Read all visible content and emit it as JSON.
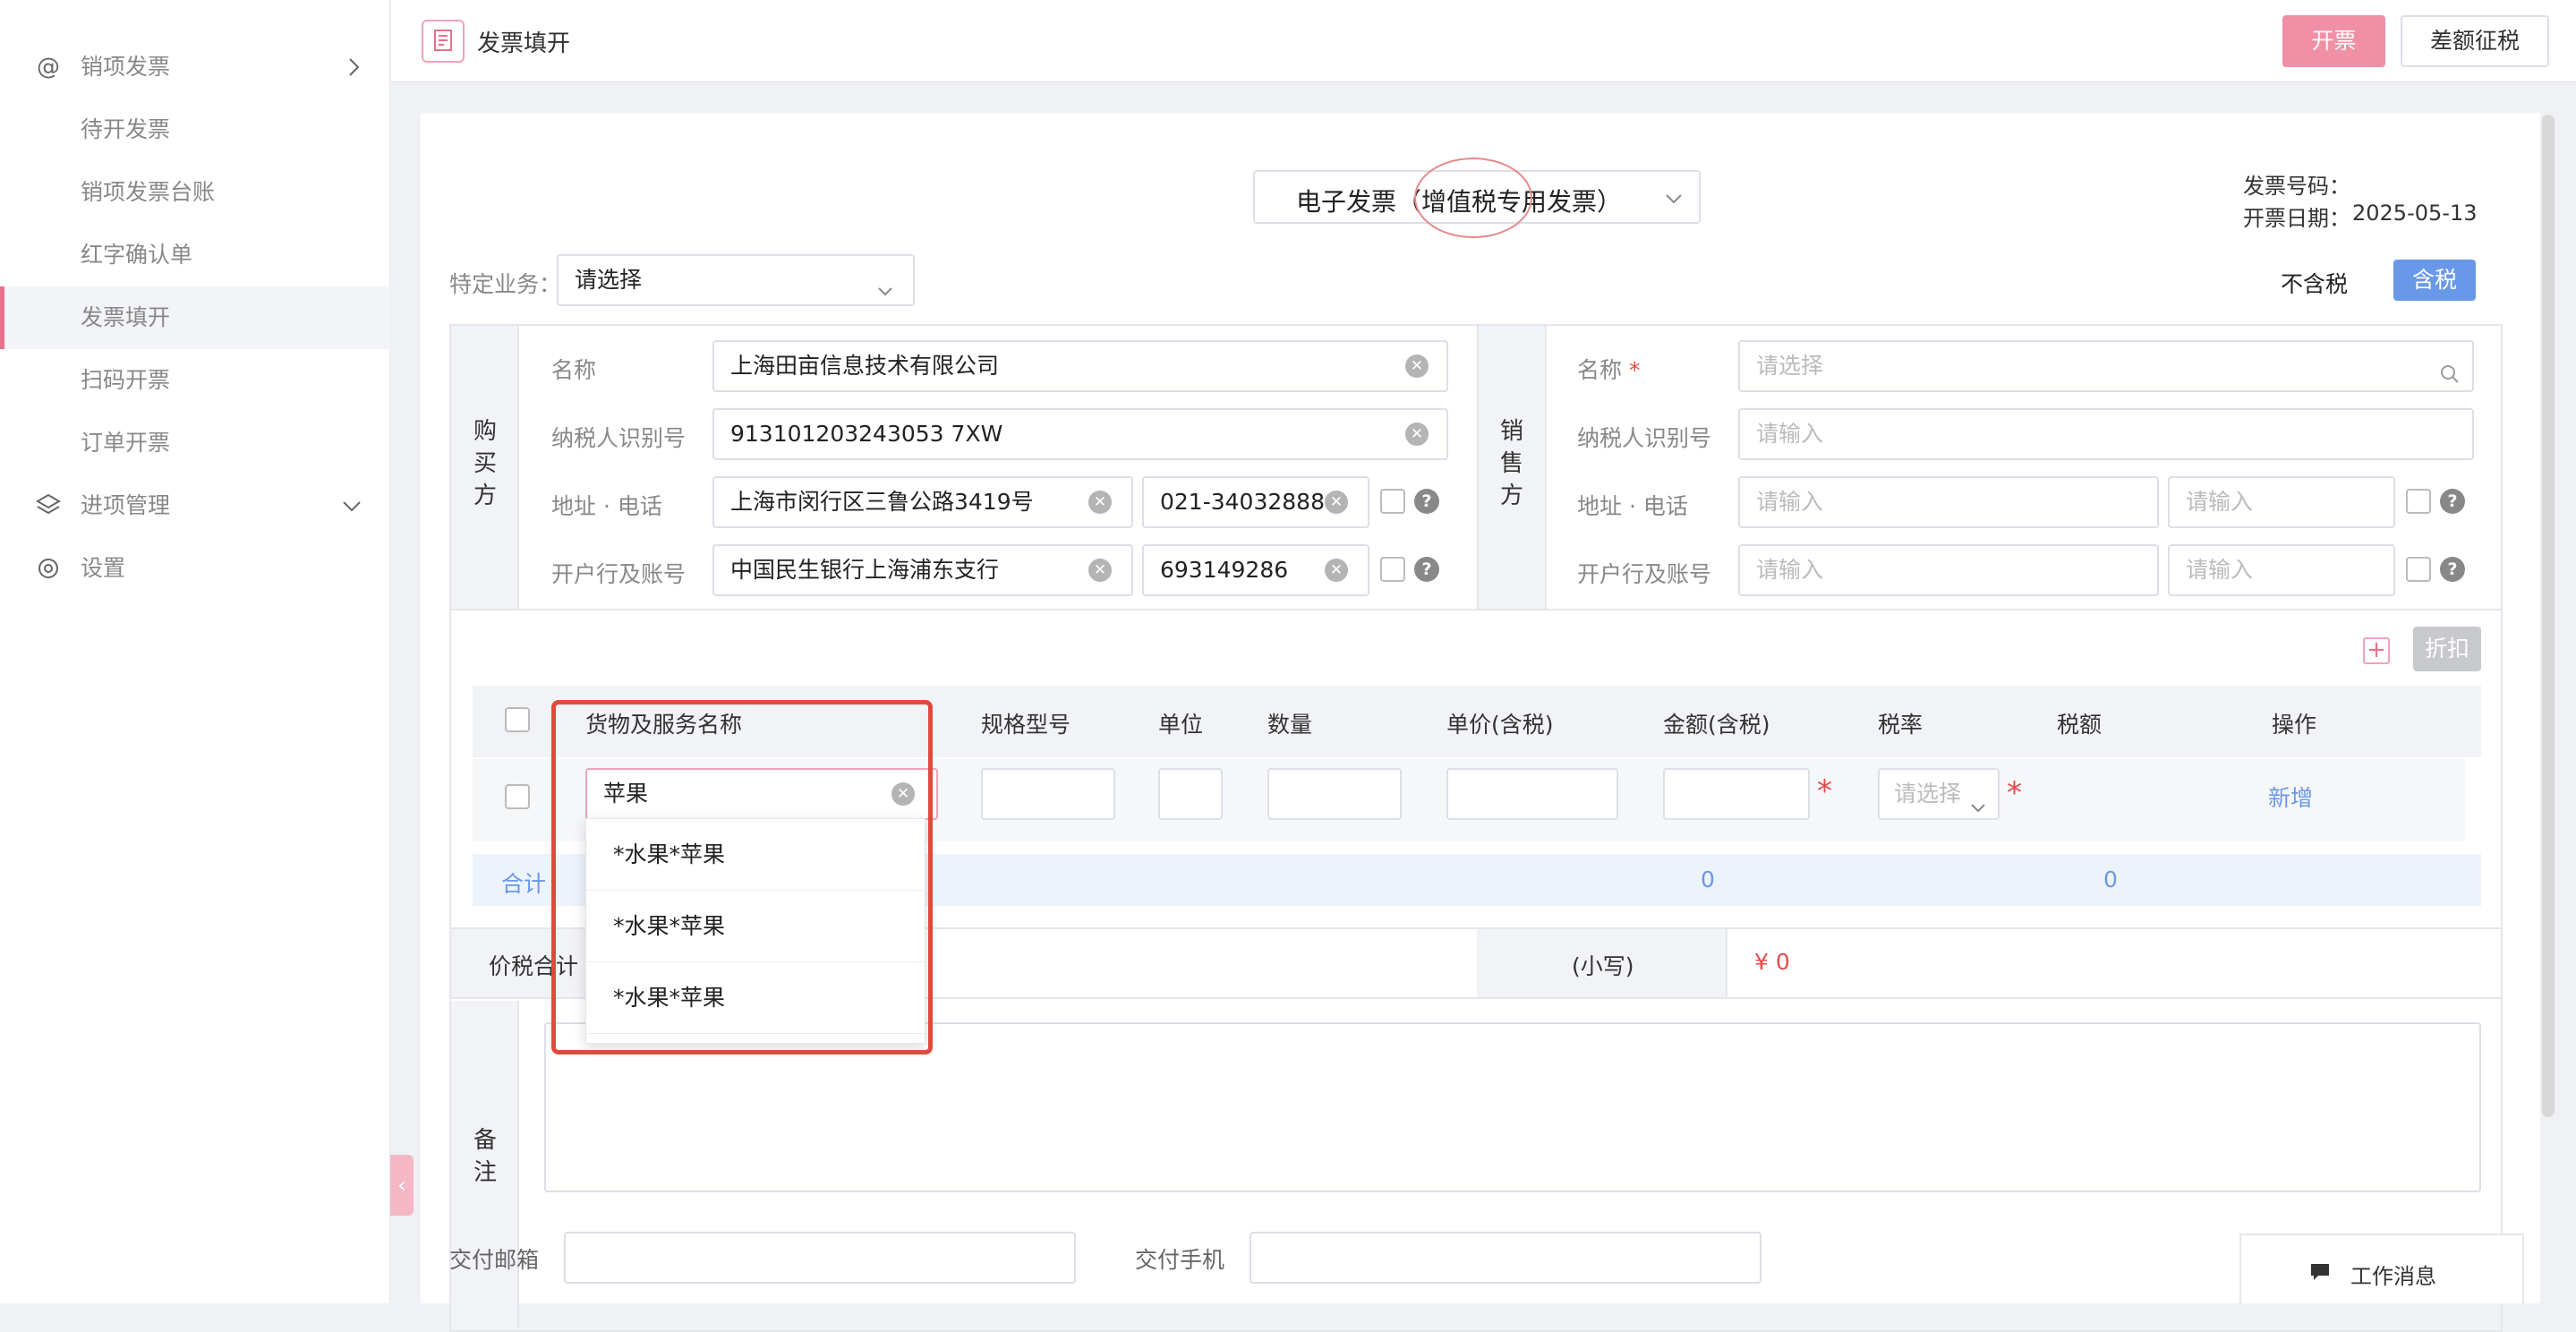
{
  "sidebar": {
    "items": [
      {
        "label": "销项发票",
        "icon": "at-icon"
      },
      {
        "label": "待开发票"
      },
      {
        "label": "销项发票台账"
      },
      {
        "label": "红字确认单"
      },
      {
        "label": "发票填开",
        "active": true
      },
      {
        "label": "扫码开票"
      },
      {
        "label": "订单开票"
      },
      {
        "label": "进项管理",
        "icon": "layers-icon"
      },
      {
        "label": "设置",
        "icon": "gear-icon"
      }
    ],
    "collapse_handle": "‹"
  },
  "topbar": {
    "title": "发票填开",
    "issue_button": "开票",
    "diff_button": "差额征税"
  },
  "invoice": {
    "type_select": "电子发票（增值税专用发票）",
    "number_label": "发票号码：",
    "date_label": "开票日期：",
    "date_value": "2025-05-13",
    "special_business_label": "特定业务：",
    "special_business_placeholder": "请选择",
    "tax_toggle_excl": "不含税",
    "tax_toggle_incl": "含税"
  },
  "buyer": {
    "section_label": [
      "购",
      "买",
      "方"
    ],
    "name_label": "名称",
    "name_value": "上海田亩信息技术有限公司",
    "taxid_label": "纳税人识别号",
    "taxid_value": "913101203243053 7XW",
    "addr_label": "地址 · 电话",
    "addr_value": "上海市闵行区三鲁公路3419号",
    "phone_value": "021-34032888",
    "bank_label": "开户行及账号",
    "bank_value": "中国民生银行上海浦东支行",
    "account_value": "693149286"
  },
  "seller": {
    "section_label": [
      "销",
      "售",
      "方"
    ],
    "name_label": "名称",
    "name_placeholder": "请选择",
    "taxid_label": "纳税人识别号",
    "taxid_placeholder": "请输入",
    "addr_label": "地址 · 电话",
    "addr_placeholder": "请输入",
    "phone_placeholder": "请输入",
    "bank_label": "开户行及账号",
    "bank_placeholder": "请输入",
    "account_placeholder": "请输入"
  },
  "items_table": {
    "discount_button": "折扣",
    "headers": [
      "货物及服务名称",
      "规格型号",
      "单位",
      "数量",
      "单价(含税)",
      "金额(含税)",
      "税率",
      "税额",
      "操作"
    ],
    "row": {
      "name_value": "苹果",
      "tax_rate_placeholder": "请选择",
      "action": "新增"
    },
    "total_label": "合计",
    "total_amount": "0",
    "total_tax": "0",
    "suggestions": [
      "*水果*苹果",
      "*水果*苹果",
      "*水果*苹果"
    ]
  },
  "summary": {
    "label": "价税合计",
    "small_label": "(小写)",
    "small_value": "¥ 0"
  },
  "remark": {
    "label": [
      "备",
      "注"
    ]
  },
  "delivery": {
    "email_label": "交付邮箱",
    "phone_label": "交付手机"
  },
  "chat": {
    "label": "工作消息"
  },
  "colors": {
    "brand_pink": "#f090a6",
    "active_pink": "#e9708c",
    "blue": "#6a98e8",
    "highlight_red": "#e04a3c"
  }
}
